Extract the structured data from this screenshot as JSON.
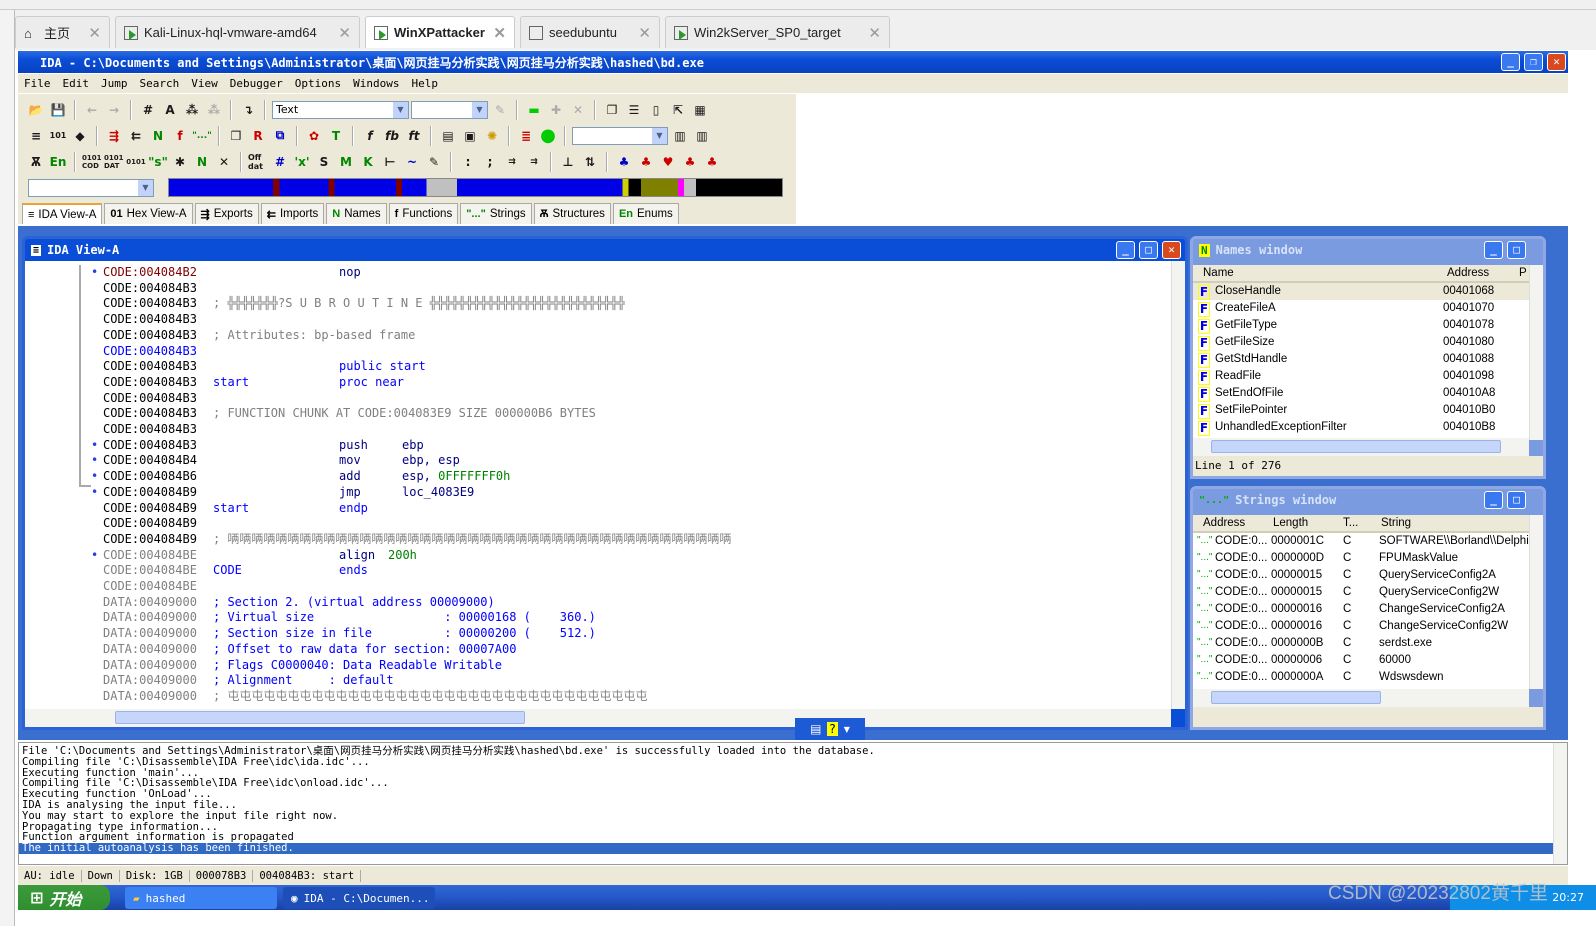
{
  "browser_tabs": [
    {
      "label": "主页",
      "icon": "home-icon"
    },
    {
      "label": "Kali-Linux-hql-vmware-amd64",
      "icon": "vm-running-icon"
    },
    {
      "label": "WinXPattacker",
      "icon": "vm-running-icon",
      "active": true
    },
    {
      "label": "seedubuntu",
      "icon": "vm-icon"
    },
    {
      "label": "Win2kServer_SP0_target",
      "icon": "vm-running-icon"
    }
  ],
  "window": {
    "title": "IDA - C:\\Documents and Settings\\Administrator\\桌面\\网页挂马分析实践\\网页挂马分析实践\\hashed\\bd.exe"
  },
  "menu": [
    "File",
    "Edit",
    "Jump",
    "Search",
    "View",
    "Debugger",
    "Options",
    "Windows",
    "Help"
  ],
  "toolbar": {
    "text_combo": "Text"
  },
  "view_tabs": [
    {
      "label": "IDA View-A",
      "icon": "≡",
      "active": true
    },
    {
      "label": "Hex View-A",
      "icon": "01"
    },
    {
      "label": "Exports",
      "icon": "⇶"
    },
    {
      "label": "Imports",
      "icon": "⇇"
    },
    {
      "label": "Names",
      "icon": "N"
    },
    {
      "label": "Functions",
      "icon": "f"
    },
    {
      "label": "Strings",
      "icon": "\"...\""
    },
    {
      "label": "Structures",
      "icon": "Ѫ"
    },
    {
      "label": "Enums",
      "icon": "En"
    }
  ],
  "ida_view": {
    "title": "IDA View-A",
    "lines": [
      {
        "addr": "CODE:004084B2",
        "mn": "nop",
        "dot": true,
        "addr_color": "#800000"
      },
      {
        "addr": "CODE:004084B3"
      },
      {
        "addr": "CODE:004084B3",
        "cm": "; ╬╬╬╬╬╬╬?S U B R O U T I N E ╬╬╬╬╬╬╬╬╬╬╬╬╬╬╬╬╬╬╬╬╬╬╬╬╬╬╬"
      },
      {
        "addr": "CODE:004084B3"
      },
      {
        "addr": "CODE:004084B3",
        "cm": "; Attributes: bp-based frame"
      },
      {
        "addr": "CODE:004084B3",
        "addr_color": "#0000ff"
      },
      {
        "addr": "CODE:004084B3",
        "mn": "public start",
        "mn_color": "#0000ff"
      },
      {
        "addr": "CODE:004084B3",
        "lbl": "start",
        "mn": "proc near",
        "mn_color": "#0000ff"
      },
      {
        "addr": "CODE:004084B3"
      },
      {
        "addr": "CODE:004084B3",
        "cm": "; FUNCTION CHUNK AT CODE:004083E9 SIZE 000000B6 BYTES"
      },
      {
        "addr": "CODE:004084B3"
      },
      {
        "addr": "CODE:004084B3",
        "mn": "push",
        "op": "ebp",
        "dot": true
      },
      {
        "addr": "CODE:004084B4",
        "mn": "mov",
        "op": "ebp, esp",
        "dot": true
      },
      {
        "addr": "CODE:004084B6",
        "mn": "add",
        "op": "esp, ",
        "op2": "0FFFFFFF0h",
        "dot": true
      },
      {
        "addr": "CODE:004084B9",
        "mn": "jmp",
        "op": "loc_4083E9",
        "dot": true
      },
      {
        "addr": "CODE:004084B9",
        "lbl": "start",
        "mn": "endp",
        "mn_color": "#0000ff"
      },
      {
        "addr": "CODE:004084B9"
      },
      {
        "addr": "CODE:004084B9",
        "cm": "; 唡唡唡唡唡唡唡唡唡唡唡唡唡唡唡唡唡唡唡唡唡唡唡唡唡唡唡唡唡唡唡唡唡唡唡唡唡唡唡唡唡唡"
      },
      {
        "addr": "CODE:004084BE",
        "mn": "align",
        "op2": "200h",
        "dot": true,
        "addr_color": "#808080"
      },
      {
        "addr": "CODE:004084BE",
        "lbl": "CODE",
        "mn": "ends",
        "mn_color": "#0000ff",
        "addr_color": "#808080"
      },
      {
        "addr": "CODE:004084BE",
        "addr_color": "#808080"
      },
      {
        "addr": "DATA:00409000",
        "cm": "; Section 2. (virtual address 00009000)",
        "cm_color": "#0000ff",
        "addr_color": "#808080"
      },
      {
        "addr": "DATA:00409000",
        "cm": "; Virtual size                  : 00000168 (    360.)",
        "cm_color": "#0000ff",
        "addr_color": "#808080"
      },
      {
        "addr": "DATA:00409000",
        "cm": "; Section size in file          : 00000200 (    512.)",
        "cm_color": "#0000ff",
        "addr_color": "#808080"
      },
      {
        "addr": "DATA:00409000",
        "cm": "; Offset to raw data for section: 00007A00",
        "cm_color": "#0000ff",
        "addr_color": "#808080"
      },
      {
        "addr": "DATA:00409000",
        "cm": "; Flags C0000040: Data Readable Writable",
        "cm_color": "#0000ff",
        "addr_color": "#808080"
      },
      {
        "addr": "DATA:00409000",
        "cm": "; Alignment     : default",
        "cm_color": "#0000ff",
        "addr_color": "#808080"
      },
      {
        "addr": "DATA:00409000",
        "cm": "; 屯屯屯屯屯屯屯屯屯屯屯屯屯屯屯屯屯屯屯屯屯屯屯屯屯屯屯屯屯屯屯屯屯屯屯",
        "addr_color": "#808080"
      }
    ]
  },
  "names_window": {
    "title": "Names window",
    "columns": [
      "Name",
      "Address",
      "P"
    ],
    "rows": [
      {
        "name": "CloseHandle",
        "address": "00401068"
      },
      {
        "name": "CreateFileA",
        "address": "00401070"
      },
      {
        "name": "GetFileType",
        "address": "00401078"
      },
      {
        "name": "GetFileSize",
        "address": "00401080"
      },
      {
        "name": "GetStdHandle",
        "address": "00401088"
      },
      {
        "name": "ReadFile",
        "address": "00401098"
      },
      {
        "name": "SetEndOfFile",
        "address": "004010A8"
      },
      {
        "name": "SetFilePointer",
        "address": "004010B0"
      },
      {
        "name": "UnhandledExceptionFilter",
        "address": "004010B8"
      }
    ],
    "status": "Line 1 of 276"
  },
  "strings_window": {
    "title": "Strings window",
    "columns": [
      "Address",
      "Length",
      "T...",
      "String"
    ],
    "rows": [
      {
        "address": "CODE:0...",
        "length": "0000001C",
        "type": "C",
        "string": "SOFTWARE\\\\Borland\\\\Delphi"
      },
      {
        "address": "CODE:0...",
        "length": "0000000D",
        "type": "C",
        "string": "FPUMaskValue"
      },
      {
        "address": "CODE:0...",
        "length": "00000015",
        "type": "C",
        "string": "QueryServiceConfig2A"
      },
      {
        "address": "CODE:0...",
        "length": "00000015",
        "type": "C",
        "string": "QueryServiceConfig2W"
      },
      {
        "address": "CODE:0...",
        "length": "00000016",
        "type": "C",
        "string": "ChangeServiceConfig2A"
      },
      {
        "address": "CODE:0...",
        "length": "00000016",
        "type": "C",
        "string": "ChangeServiceConfig2W"
      },
      {
        "address": "CODE:0...",
        "length": "0000000B",
        "type": "C",
        "string": "serdst.exe"
      },
      {
        "address": "CODE:0...",
        "length": "00000006",
        "type": "C",
        "string": "60000"
      },
      {
        "address": "CODE:0...",
        "length": "0000000A",
        "type": "C",
        "string": "Wdswsdewn"
      }
    ]
  },
  "output": [
    "File 'C:\\Documents and Settings\\Administrator\\桌面\\网页挂马分析实践\\网页挂马分析实践\\hashed\\bd.exe' is successfully loaded into the database.",
    "Compiling file 'C:\\Disassemble\\IDA Free\\idc\\ida.idc'...",
    "Executing function 'main'...",
    "Compiling file 'C:\\Disassemble\\IDA Free\\idc\\onload.idc'...",
    "Executing function 'OnLoad'...",
    "IDA is analysing the input file...",
    "You may start to explore the input file right now.",
    "Propagating type information...",
    "Function argument information is propagated",
    "The initial autoanalysis has been finished."
  ],
  "status": {
    "au": "AU:  idle",
    "dir": "Down",
    "disk": "Disk: 1GB",
    "offset": "000078B3",
    "location": "004084B3: start"
  },
  "taskbar": {
    "start": "开始",
    "tasks": [
      "hashed",
      "IDA - C:\\Documen..."
    ],
    "clock": "20:27"
  },
  "watermark": "CSDN @20232802黄千里"
}
